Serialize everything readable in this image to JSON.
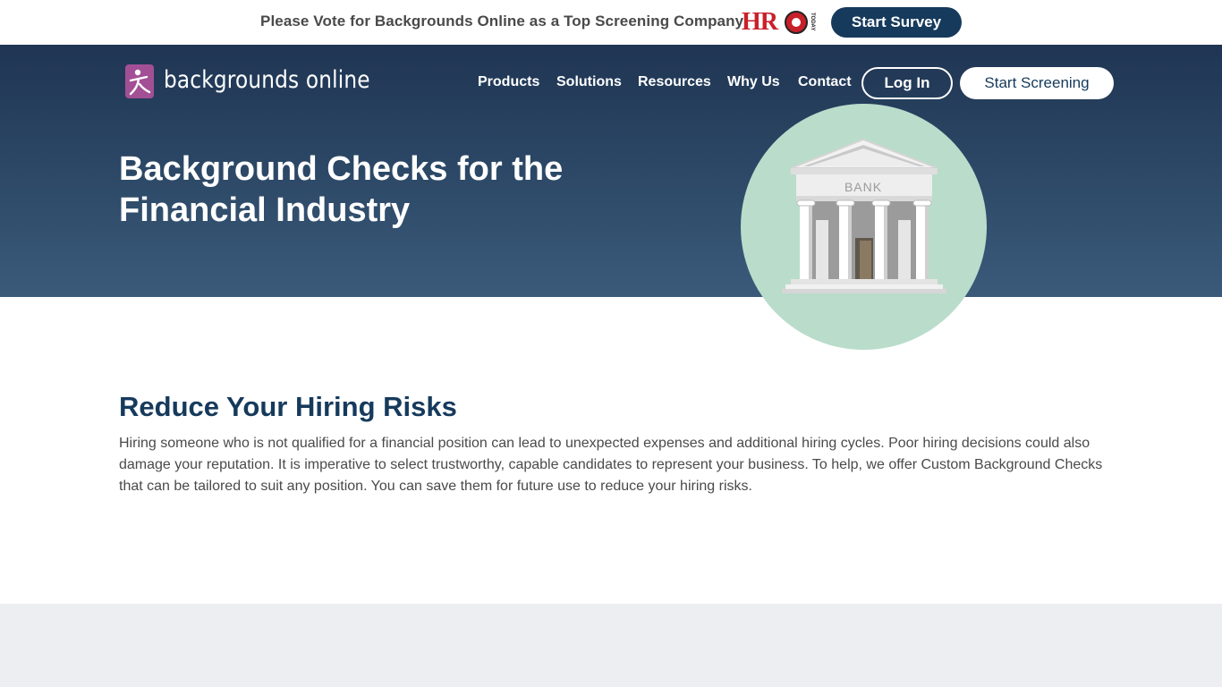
{
  "announcement": {
    "text": "Please Vote for Backgrounds Online as a Top Screening Company",
    "partner_logo_text": "HR",
    "partner_logo_small": "TODAY",
    "survey_button": "Start Survey"
  },
  "header": {
    "logo_text": "backgrounds online",
    "nav": [
      "Products",
      "Solutions",
      "Resources",
      "Why Us",
      "Contact"
    ],
    "login_button": "Log In",
    "cta_button": "Start Screening"
  },
  "hero": {
    "title": "Background Checks for the Financial Industry",
    "illustration_label": "BANK"
  },
  "main": {
    "section_title": "Reduce Your Hiring Risks",
    "section_body": "Hiring someone who is not qualified for a financial position can lead to unexpected expenses and additional hiring cycles. Poor hiring decisions could also damage your reputation. It is imperative to select trustworthy, capable candidates to represent your business. To help, we offer Custom Background Checks that can be tailored to suit any position. You can save them for future use to reduce your hiring risks."
  },
  "colors": {
    "navy": "#163a5c",
    "hero_top": "#1f3553",
    "hero_bottom": "#3b5a7a",
    "brand_purple": "#a24f95",
    "circle_green": "#badccb",
    "hro_red": "#c8202a"
  }
}
